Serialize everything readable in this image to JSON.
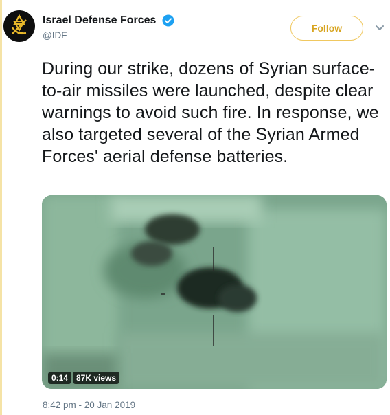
{
  "author": {
    "display_name": "Israel Defense Forces",
    "handle": "@IDF",
    "verified": true,
    "avatar_icon": "idf-emblem-icon"
  },
  "follow_label": "Follow",
  "tweet_text": "During our strike, dozens of Syrian surface-to-air missiles were launched, despite clear warnings to avoid such fire. In response, we also targeted several of the Syrian Armed Forces' aerial defense batteries.",
  "media": {
    "duration": "0:14",
    "views": "87K views"
  },
  "timestamp": "8:42 pm - 20 Jan 2019",
  "colors": {
    "follow_accent": "#d8a521",
    "verified_blue": "#1da1f2",
    "secondary_text": "#657786"
  }
}
